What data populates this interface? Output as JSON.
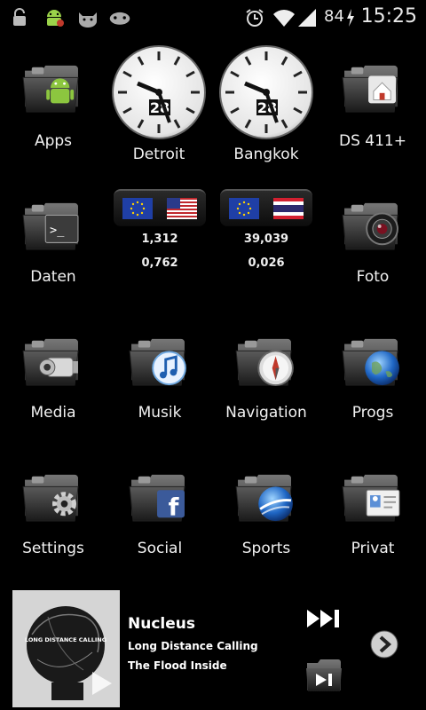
{
  "status_bar": {
    "icons": [
      "lock-open-icon",
      "android-icon",
      "cat-icon",
      "gamepad-icon",
      "alarm-icon",
      "wifi-icon",
      "signal-icon"
    ],
    "battery": "84",
    "time": "15:25"
  },
  "clocks": [
    {
      "city": "Detroit",
      "date": "28"
    },
    {
      "city": "Bangkok",
      "date": "28"
    }
  ],
  "currency": [
    {
      "from": "EU",
      "to": "US",
      "rate1": "1,312",
      "rate2": "0,762"
    },
    {
      "from": "EU",
      "to": "TH",
      "rate1": "39,039",
      "rate2": "0,026"
    }
  ],
  "folders": {
    "apps": "Apps",
    "ds411": "DS 411+",
    "daten": "Daten",
    "foto": "Foto",
    "media": "Media",
    "musik": "Musik",
    "navigation": "Navigation",
    "progs": "Progs",
    "settings": "Settings",
    "social": "Social",
    "sports": "Sports",
    "privat": "Privat"
  },
  "music": {
    "title": "Nucleus",
    "artist": "Long Distance Calling",
    "album": "The Flood Inside",
    "cover_text": "LONG DISTANCE CALLING"
  },
  "colors": {
    "background": "#000000",
    "text": "#f2f2f2",
    "folder_dark": "#3a3a3a"
  }
}
